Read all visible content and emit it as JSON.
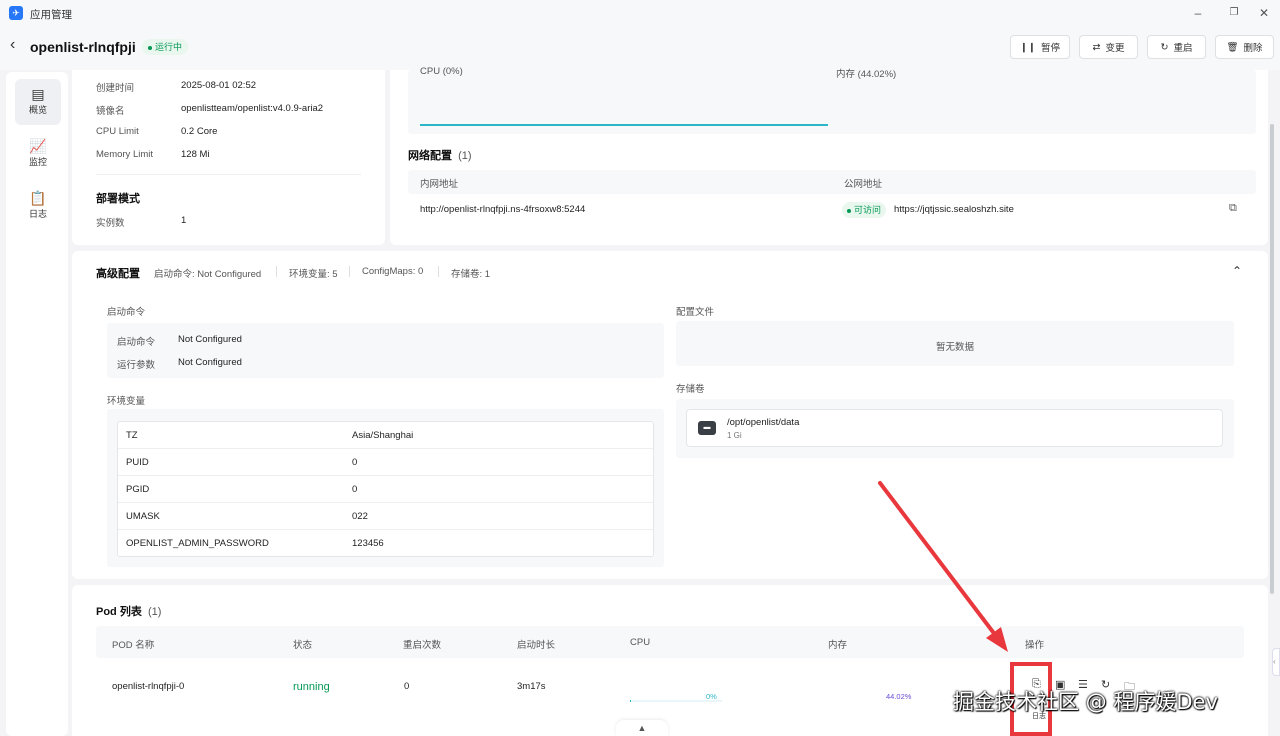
{
  "titlebar": {
    "app_icon": "rocket-icon",
    "title": "应用管理"
  },
  "header": {
    "app_name": "openlist-rlnqfpji",
    "status": "运行中",
    "buttons": {
      "pause": "暂停",
      "change": "变更",
      "restart": "重启",
      "delete": "删除"
    }
  },
  "sidebar": {
    "items": [
      {
        "label": "概览",
        "icon": "overview-icon"
      },
      {
        "label": "监控",
        "icon": "chart-icon"
      },
      {
        "label": "日志",
        "icon": "log-icon"
      }
    ]
  },
  "basic_info": {
    "rows": [
      {
        "label": "创建时间",
        "value": "2025-08-01 02:52"
      },
      {
        "label": "镜像名",
        "value": "openlistteam/openlist:v4.0.9-aria2"
      },
      {
        "label": "CPU Limit",
        "value": "0.2 Core"
      },
      {
        "label": "Memory Limit",
        "value": "128 Mi"
      }
    ],
    "deploy_title": "部署模式",
    "replicas_label": "实例数",
    "replicas_value": "1"
  },
  "monitor": {
    "cpu_label": "CPU (0%)",
    "mem_label": "内存 (44.02%)"
  },
  "network": {
    "title": "网络配置",
    "count": "(1)",
    "col_internal": "内网地址",
    "col_public": "公网地址",
    "internal": "http://openlist-rlnqfpji.ns-4frsoxw8:5244",
    "accessible": "可访问",
    "public": "https://jqtjssic.sealoshzh.site"
  },
  "advanced": {
    "title": "高级配置",
    "summary": [
      "启动命令: Not Configured",
      "环境变量: 5",
      "ConfigMaps: 0",
      "存储卷: 1"
    ],
    "startup_title": "启动命令",
    "startup_cmd_label": "启动命令",
    "startup_cmd_value": "Not Configured",
    "run_args_label": "运行参数",
    "run_args_value": "Not Configured",
    "env_title": "环境变量",
    "env": [
      {
        "key": "TZ",
        "value": "Asia/Shanghai"
      },
      {
        "key": "PUID",
        "value": "0"
      },
      {
        "key": "PGID",
        "value": "0"
      },
      {
        "key": "UMASK",
        "value": "022"
      },
      {
        "key": "OPENLIST_ADMIN_PASSWORD",
        "value": "123456"
      }
    ],
    "config_title": "配置文件",
    "config_empty": "暂无数据",
    "storage_title": "存储卷",
    "storage_path": "/opt/openlist/data",
    "storage_size": "1 Gi"
  },
  "pods": {
    "title": "Pod 列表",
    "count": "(1)",
    "columns": [
      "POD 名称",
      "状态",
      "重启次数",
      "启动时长",
      "CPU",
      "内存",
      "操作"
    ],
    "row": {
      "name": "openlist-rlnqfpji-0",
      "status": "running",
      "restarts": "0",
      "uptime": "3m17s",
      "cpu": "0%",
      "mem": "44.02%",
      "log_label": "日志"
    },
    "cpu_fraction": 0.0,
    "mem_fraction": 0.4402
  },
  "watermark": "掘金技术社区 @ 程序媛Dev",
  "colors": {
    "accent": "#2778f8",
    "success": "#039855",
    "annotation": "#e8383d",
    "chart_line": "#2bb5c8",
    "mem_text": "#6c4ed8"
  }
}
